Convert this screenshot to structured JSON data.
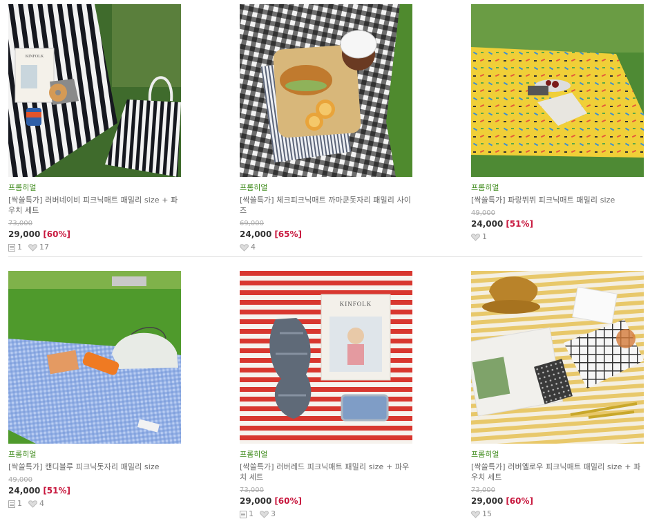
{
  "products": [
    {
      "brand": "프롬히얼",
      "title": "[싹쓸특가] 러버네이비 피크닉매트 패밀리 size + 파우치 세트",
      "original_price": "73,000",
      "price": "29,000",
      "discount": "[60%]",
      "reviews": "1",
      "likes": "17",
      "image": "navy-stripe-picnic-mat"
    },
    {
      "brand": "프롬히얼",
      "title": "[싹쓸특가] 체크피크닉매트 까마쿤돗자리 패밀리 사이즈",
      "original_price": "69,000",
      "price": "24,000",
      "discount": "[65%]",
      "reviews": "",
      "likes": "4",
      "image": "black-gingham-picnic-mat"
    },
    {
      "brand": "프롬히얼",
      "title": "[싹쓸특가] 파랑뛰뛰 피크닉매트 패밀리 size",
      "original_price": "49,000",
      "price": "24,000",
      "discount": "[51%]",
      "reviews": "",
      "likes": "1",
      "image": "yellow-pattern-picnic-mat"
    },
    {
      "brand": "프롬히얼",
      "title": "[싹쓸특가] 캔디블루 피크닉돗자리 패밀리 size",
      "original_price": "49,000",
      "price": "24,000",
      "discount": "[51%]",
      "reviews": "1",
      "likes": "4",
      "image": "blue-gingham-picnic-mat"
    },
    {
      "brand": "프롬히얼",
      "title": "[싹쓸특가] 러버레드 피크닉매트 패밀리 size + 파우치 세트",
      "original_price": "73,000",
      "price": "29,000",
      "discount": "[60%]",
      "reviews": "1",
      "likes": "3",
      "image": "red-stripe-picnic-mat"
    },
    {
      "brand": "프롬히얼",
      "title": "[싹쓸특가] 러버옐로우 피크닉매트 패밀리 size + 파우치 세트",
      "original_price": "73,000",
      "price": "29,000",
      "discount": "[60%]",
      "reviews": "",
      "likes": "15",
      "image": "yellow-stripe-picnic-mat"
    }
  ],
  "colors": {
    "brand": "#3d8a1a",
    "discount": "#c8183e",
    "original": "#aaaaaa"
  },
  "image_text": {
    "magazine": "KINFOLK"
  }
}
